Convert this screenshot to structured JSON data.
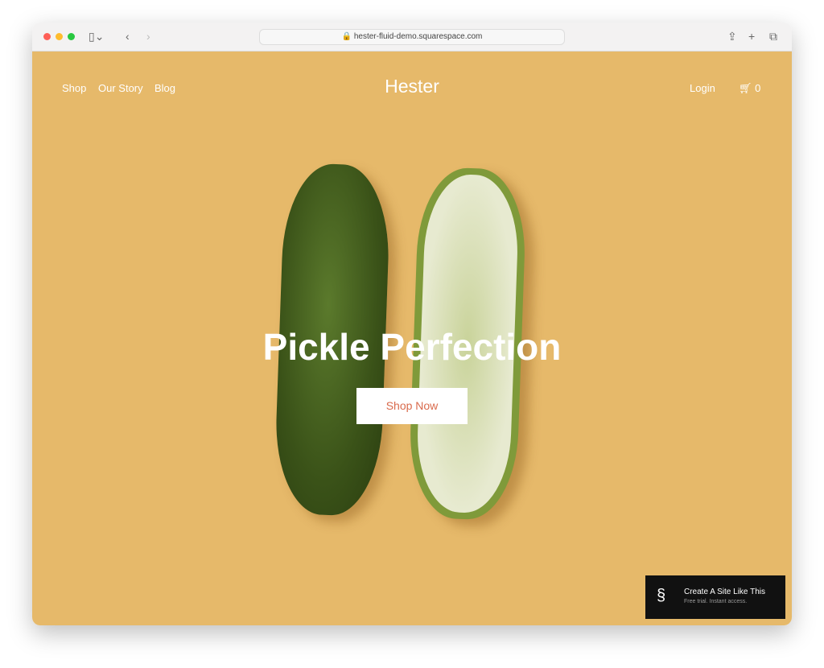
{
  "browser": {
    "url": "hester-fluid-demo.squarespace.com"
  },
  "nav": {
    "left": [
      "Shop",
      "Our Story",
      "Blog"
    ],
    "logo": "Hester",
    "login": "Login",
    "cart_count": "0"
  },
  "hero": {
    "title": "Pickle Perfection",
    "button": "Shop Now",
    "background": "#e6b96a",
    "button_text_color": "#d96a4c"
  },
  "badge": {
    "title": "Create A Site Like This",
    "subtitle": "Free trial. Instant access."
  }
}
